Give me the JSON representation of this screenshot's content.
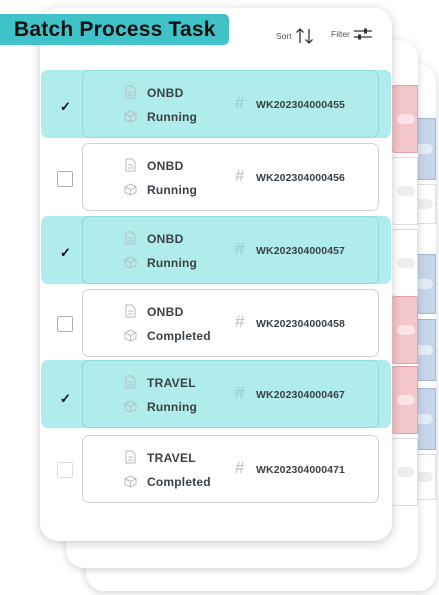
{
  "header": {
    "title": "Batch Process Task",
    "sort_label": "Sort",
    "filter_label": "Filter",
    "accent_color": "#3fc3c8"
  },
  "tasks": [
    {
      "type": "ONBD",
      "status": "Running",
      "id": "WK202304000455",
      "selected": true
    },
    {
      "type": "ONBD",
      "status": "Running",
      "id": "WK202304000456",
      "selected": false
    },
    {
      "type": "ONBD",
      "status": "Running",
      "id": "WK202304000457",
      "selected": true
    },
    {
      "type": "ONBD",
      "status": "Completed",
      "id": "WK202304000458",
      "selected": false
    },
    {
      "type": "TRAVEL",
      "status": "Running",
      "id": "WK202304000467",
      "selected": true
    },
    {
      "type": "TRAVEL",
      "status": "Completed",
      "id": "WK202304000471",
      "selected": false
    }
  ],
  "icons": {
    "check": "✓",
    "hash": "#",
    "sort": "sort-arrows-icon",
    "filter": "filter-sliders-icon",
    "document": "document-icon",
    "package": "package-icon"
  },
  "colors": {
    "selected_row": "#b0ecec",
    "peek_red": "#f3c6c9",
    "peek_blue": "#c6d6ea"
  }
}
